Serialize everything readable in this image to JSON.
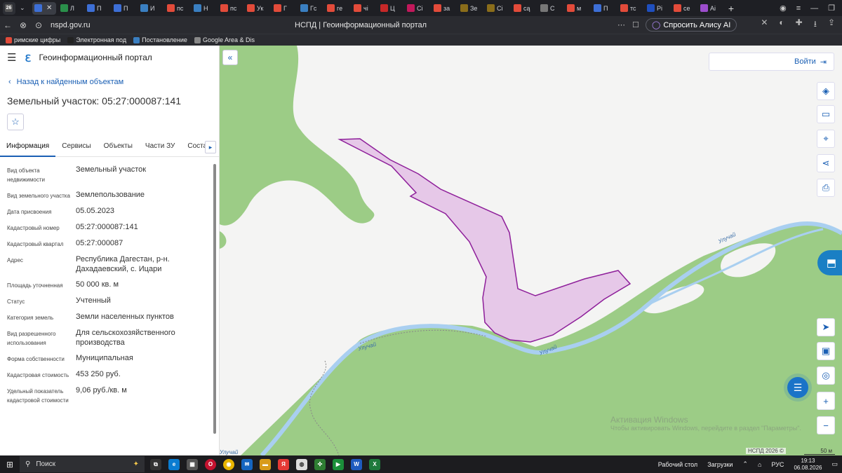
{
  "browser": {
    "tabs": [
      {
        "label": "",
        "color": "#3d6fd6",
        "active": true
      },
      {
        "label": "Л",
        "color": "#2a8f4a"
      },
      {
        "label": "П",
        "color": "#3d6fd6"
      },
      {
        "label": "П",
        "color": "#3d6fd6"
      },
      {
        "label": "И",
        "color": "#3a7fc1"
      },
      {
        "label": "пс",
        "color": "#e24b3a"
      },
      {
        "label": "Н",
        "color": "#3a7fc1"
      },
      {
        "label": "пс",
        "color": "#e24b3a"
      },
      {
        "label": "Ук",
        "color": "#e24b3a"
      },
      {
        "label": "Г",
        "color": "#e24b3a"
      },
      {
        "label": "Гс",
        "color": "#3a7fc1"
      },
      {
        "label": "ге",
        "color": "#e24b3a"
      },
      {
        "label": "чі",
        "color": "#e24b3a"
      },
      {
        "label": "Ц",
        "color": "#c62828"
      },
      {
        "label": "Сі",
        "color": "#c2185b"
      },
      {
        "label": "за",
        "color": "#e24b3a"
      },
      {
        "label": "Зе",
        "color": "#8a6d1a"
      },
      {
        "label": "Сі",
        "color": "#8a6d1a"
      },
      {
        "label": "сą",
        "color": "#e24b3a"
      },
      {
        "label": "С",
        "color": "#777777"
      },
      {
        "label": "м",
        "color": "#e24b3a"
      },
      {
        "label": "П",
        "color": "#3d6fd6"
      },
      {
        "label": "тс",
        "color": "#e24b3a"
      },
      {
        "label": "Рі",
        "color": "#1f4fbf"
      },
      {
        "label": "се",
        "color": "#e24b3a"
      },
      {
        "label": "Аі",
        "color": "#9c4dcc"
      }
    ],
    "url": "nspd.gov.ru",
    "page_title": "НСПД | Геоинформационный портал",
    "alice_label": "Спросить Алису AI",
    "bookmarks": [
      {
        "label": "римские цифры",
        "color": "#e24b3a"
      },
      {
        "label": "Электронная под",
        "color": "#222222"
      },
      {
        "label": "Постановление",
        "color": "#3a7fc1"
      },
      {
        "label": "Google Area & Dis",
        "color": "#888888"
      }
    ]
  },
  "panel": {
    "portal_name": "Геоинформационный портал",
    "back_link": "Назад к найденным объектам",
    "object_title": "Земельный участок: 05:27:000087:141",
    "tabs": [
      "Информация",
      "Сервисы",
      "Объекты",
      "Части ЗУ",
      "Состав"
    ],
    "properties": [
      {
        "key": "Вид объекта недвижимости",
        "value": "Земельный участок"
      },
      {
        "key": "Вид земельного участка",
        "value": "Землепользование"
      },
      {
        "key": "Дата присвоения",
        "value": "05.05.2023"
      },
      {
        "key": "Кадастровый номер",
        "value": "05:27:000087:141"
      },
      {
        "key": "Кадастровый квартал",
        "value": "05:27:000087"
      },
      {
        "key": "Адрес",
        "value": "Республика Дагестан, р-н. Дахадаевский, с. Ицари"
      },
      {
        "key": "Площадь уточненная",
        "value": "50 000 кв. м"
      },
      {
        "key": "Статус",
        "value": "Учтенный"
      },
      {
        "key": "Категория земель",
        "value": "Земли населенных пунктов"
      },
      {
        "key": "Вид разрешенного использования",
        "value": "Для сельскохозяйственного производства"
      },
      {
        "key": "Форма собственности",
        "value": "Муниципальная"
      },
      {
        "key": "Кадастровая стоимость",
        "value": "453 250 руб."
      },
      {
        "key": "Удельный показатель кадастровой стоимости",
        "value": "9,06 руб./кв. м"
      }
    ]
  },
  "map": {
    "login_label": "Войти",
    "river_name": "Улучай",
    "river_name_partial": "Улучай",
    "watermark_title": "Активация Windows",
    "watermark_sub": "Чтобы активировать Windows, перейдите в раздел \"Параметры\".",
    "attribution": "НСПД 2026 ©",
    "scale": "50 м",
    "colors": {
      "parcel_fill": "#e6c8e8",
      "parcel_stroke": "#8e1f9a",
      "forest": "#9ccc86",
      "river": "#a9cff0"
    }
  },
  "taskbar": {
    "search_placeholder": "Поиск",
    "desktop_label": "Рабочий стол",
    "downloads_label": "Загрузки",
    "lang": "РУС",
    "time": "19:13",
    "date": "06.08.2026"
  }
}
